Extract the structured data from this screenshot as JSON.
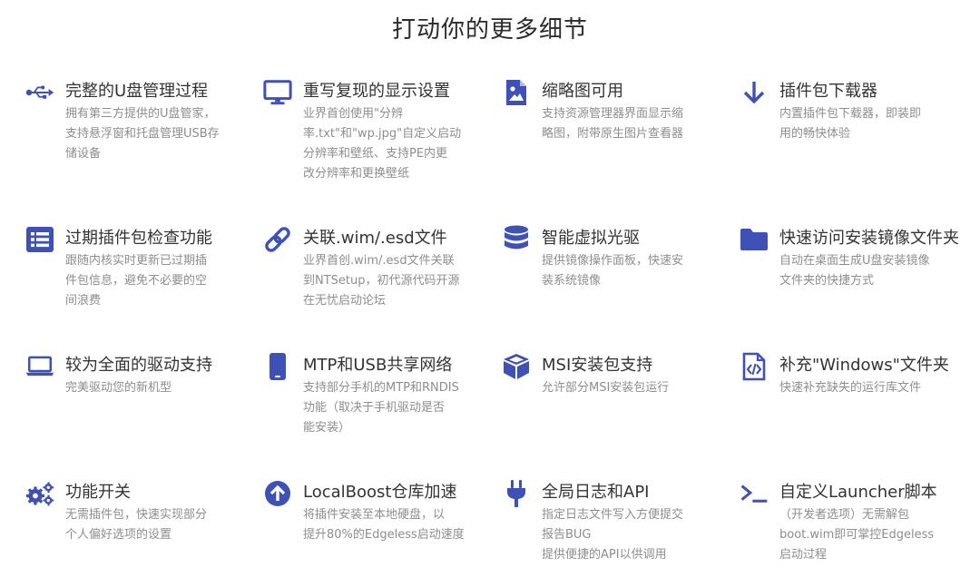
{
  "page": {
    "title": "打动你的更多细节"
  },
  "accent": "#3f51b5",
  "features": [
    {
      "icon": "usb-icon",
      "title": "完整的U盘管理过程",
      "desc": [
        "拥有第三方提供的U盘管家，",
        "支持悬浮窗和托盘管理USB存",
        "储设备"
      ]
    },
    {
      "icon": "monitor-icon",
      "title": "重写复现的显示设置",
      "desc": [
        "业界首创使用\"分辨",
        "率.txt\"和\"wp.jpg\"自定义启动",
        "分辨率和壁纸、支持PE内更",
        "改分辨率和更换壁纸"
      ]
    },
    {
      "icon": "image-file-icon",
      "title": "缩略图可用",
      "desc": [
        "支持资源管理器界面显示缩",
        "略图，附带原生图片查看器"
      ]
    },
    {
      "icon": "download-arrow-icon",
      "title": "插件包下载器",
      "desc": [
        "内置插件包下载器，即装即",
        "用的畅快体验"
      ]
    },
    {
      "icon": "list-icon",
      "title": "过期插件包检查功能",
      "desc": [
        "跟随内核实时更新已过期插",
        "件包信息，避免不必要的空",
        "间浪费"
      ]
    },
    {
      "icon": "link-icon",
      "title": "关联.wim/.esd文件",
      "desc": [
        "业界首创.wim/.esd文件关联",
        "到NTSetup，初代源代码开源",
        "在无忧启动论坛"
      ]
    },
    {
      "icon": "database-icon",
      "title": "智能虚拟光驱",
      "desc": [
        "提供镜像操作面板，快速安",
        "装系统镜像"
      ]
    },
    {
      "icon": "folder-icon",
      "title": "快速访问安装镜像文件夹",
      "desc": [
        "自动在桌面生成U盘安装镜像",
        "文件夹的快捷方式"
      ]
    },
    {
      "icon": "laptop-icon",
      "title": "较为全面的驱动支持",
      "desc": [
        "完美驱动您的新机型"
      ]
    },
    {
      "icon": "mobile-phone-icon",
      "title": "MTP和USB共享网络",
      "desc": [
        "支持部分手机的MTP和RNDIS",
        "功能（取决于手机驱动是否",
        "能安装）"
      ]
    },
    {
      "icon": "cube-icon",
      "title": "MSI安装包支持",
      "desc": [
        "允许部分MSI安装包运行"
      ]
    },
    {
      "icon": "code-file-icon",
      "title": "补充\"Windows\"文件夹",
      "desc": [
        "快速补充缺失的运行库文件"
      ]
    },
    {
      "icon": "gears-icon",
      "title": "功能开关",
      "desc": [
        "无需插件包，快速实现部分",
        "个人偏好选项的设置"
      ]
    },
    {
      "icon": "arrow-circle-up-icon",
      "title": "LocalBoost仓库加速",
      "desc": [
        "将插件安装至本地硬盘，以",
        "提升80%的Edgeless启动速度"
      ]
    },
    {
      "icon": "plug-icon",
      "title": "全局日志和API",
      "desc": [
        "指定日志文件写入方便提交",
        "报告BUG",
        "提供便捷的API以供调用"
      ]
    },
    {
      "icon": "terminal-icon",
      "title": "自定义Launcher脚本",
      "desc": [
        "（开发者选项）无需解包",
        "boot.wim即可掌控Edgeless",
        "启动过程"
      ]
    }
  ]
}
